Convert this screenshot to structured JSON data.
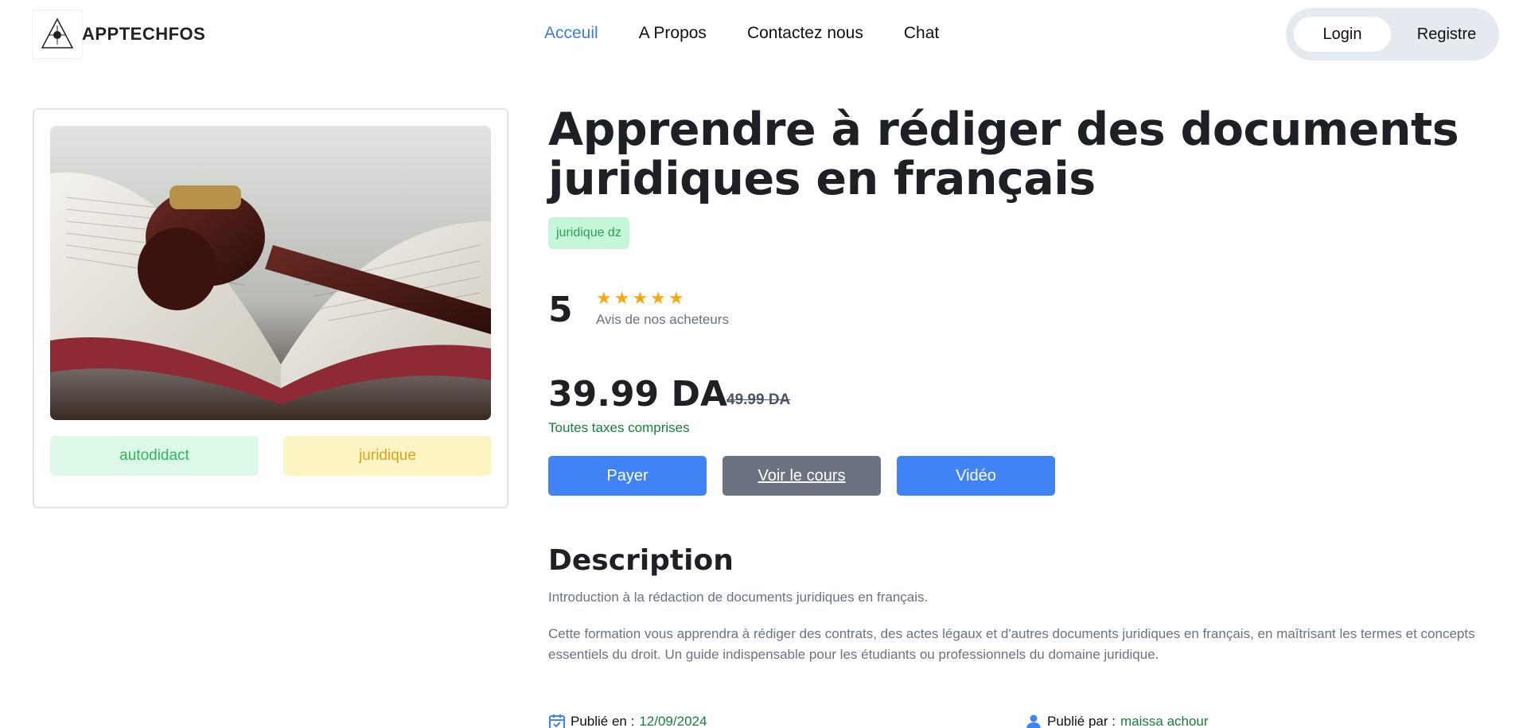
{
  "header": {
    "brand": "APPTECHFOS",
    "logo_icon": "triangle-eye-logo",
    "nav": [
      {
        "label": "Acceuil",
        "active": true
      },
      {
        "label": "A Propos",
        "active": false
      },
      {
        "label": "Contactez nous",
        "active": false
      },
      {
        "label": "Chat",
        "active": false
      }
    ],
    "login_label": "Login",
    "register_label": "Registre"
  },
  "course": {
    "image_icon": "gavel-on-book-image",
    "tags": [
      "autodidact",
      "juridique"
    ],
    "title": "Apprendre à rédiger des documents juridiques en français",
    "category": "juridique dz",
    "rating": "5",
    "stars": 5,
    "rating_caption": "Avis de nos acheteurs",
    "price": "39.99 DA",
    "old_price": "49.99 DA",
    "taxes": "Toutes taxes comprises",
    "buttons": {
      "pay": "Payer",
      "course": "Voir le cours",
      "video": "Vidéo"
    },
    "description_title": "Description",
    "description_intro": "Introduction à la rédaction de documents juridiques en français.",
    "description_body": "Cette formation vous apprendra à rédiger des contrats, des actes légaux et d'autres documents juridiques en français, en maîtrisant les termes et concepts essentiels du droit. Un guide indispensable pour les étudiants ou professionnels du domaine juridique.",
    "published_label": "Publié en :",
    "published_date": "12/09/2024",
    "author_label": "Publié par :",
    "author_name": "maissa achour"
  },
  "colors": {
    "accent": "#3f83f4",
    "nav_active": "#3b7ddd",
    "star": "#f7a812",
    "green_text": "#14803c"
  }
}
